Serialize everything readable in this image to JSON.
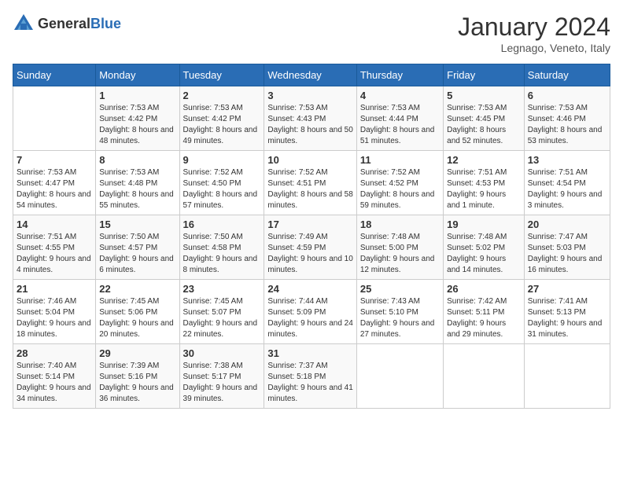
{
  "header": {
    "logo_general": "General",
    "logo_blue": "Blue",
    "month": "January 2024",
    "location": "Legnago, Veneto, Italy"
  },
  "weekdays": [
    "Sunday",
    "Monday",
    "Tuesday",
    "Wednesday",
    "Thursday",
    "Friday",
    "Saturday"
  ],
  "weeks": [
    [
      {
        "day": "",
        "sunrise": "",
        "sunset": "",
        "daylight": ""
      },
      {
        "day": "1",
        "sunrise": "Sunrise: 7:53 AM",
        "sunset": "Sunset: 4:42 PM",
        "daylight": "Daylight: 8 hours and 48 minutes."
      },
      {
        "day": "2",
        "sunrise": "Sunrise: 7:53 AM",
        "sunset": "Sunset: 4:42 PM",
        "daylight": "Daylight: 8 hours and 49 minutes."
      },
      {
        "day": "3",
        "sunrise": "Sunrise: 7:53 AM",
        "sunset": "Sunset: 4:43 PM",
        "daylight": "Daylight: 8 hours and 50 minutes."
      },
      {
        "day": "4",
        "sunrise": "Sunrise: 7:53 AM",
        "sunset": "Sunset: 4:44 PM",
        "daylight": "Daylight: 8 hours and 51 minutes."
      },
      {
        "day": "5",
        "sunrise": "Sunrise: 7:53 AM",
        "sunset": "Sunset: 4:45 PM",
        "daylight": "Daylight: 8 hours and 52 minutes."
      },
      {
        "day": "6",
        "sunrise": "Sunrise: 7:53 AM",
        "sunset": "Sunset: 4:46 PM",
        "daylight": "Daylight: 8 hours and 53 minutes."
      }
    ],
    [
      {
        "day": "7",
        "sunrise": "Sunrise: 7:53 AM",
        "sunset": "Sunset: 4:47 PM",
        "daylight": "Daylight: 8 hours and 54 minutes."
      },
      {
        "day": "8",
        "sunrise": "Sunrise: 7:53 AM",
        "sunset": "Sunset: 4:48 PM",
        "daylight": "Daylight: 8 hours and 55 minutes."
      },
      {
        "day": "9",
        "sunrise": "Sunrise: 7:52 AM",
        "sunset": "Sunset: 4:50 PM",
        "daylight": "Daylight: 8 hours and 57 minutes."
      },
      {
        "day": "10",
        "sunrise": "Sunrise: 7:52 AM",
        "sunset": "Sunset: 4:51 PM",
        "daylight": "Daylight: 8 hours and 58 minutes."
      },
      {
        "day": "11",
        "sunrise": "Sunrise: 7:52 AM",
        "sunset": "Sunset: 4:52 PM",
        "daylight": "Daylight: 8 hours and 59 minutes."
      },
      {
        "day": "12",
        "sunrise": "Sunrise: 7:51 AM",
        "sunset": "Sunset: 4:53 PM",
        "daylight": "Daylight: 9 hours and 1 minute."
      },
      {
        "day": "13",
        "sunrise": "Sunrise: 7:51 AM",
        "sunset": "Sunset: 4:54 PM",
        "daylight": "Daylight: 9 hours and 3 minutes."
      }
    ],
    [
      {
        "day": "14",
        "sunrise": "Sunrise: 7:51 AM",
        "sunset": "Sunset: 4:55 PM",
        "daylight": "Daylight: 9 hours and 4 minutes."
      },
      {
        "day": "15",
        "sunrise": "Sunrise: 7:50 AM",
        "sunset": "Sunset: 4:57 PM",
        "daylight": "Daylight: 9 hours and 6 minutes."
      },
      {
        "day": "16",
        "sunrise": "Sunrise: 7:50 AM",
        "sunset": "Sunset: 4:58 PM",
        "daylight": "Daylight: 9 hours and 8 minutes."
      },
      {
        "day": "17",
        "sunrise": "Sunrise: 7:49 AM",
        "sunset": "Sunset: 4:59 PM",
        "daylight": "Daylight: 9 hours and 10 minutes."
      },
      {
        "day": "18",
        "sunrise": "Sunrise: 7:48 AM",
        "sunset": "Sunset: 5:00 PM",
        "daylight": "Daylight: 9 hours and 12 minutes."
      },
      {
        "day": "19",
        "sunrise": "Sunrise: 7:48 AM",
        "sunset": "Sunset: 5:02 PM",
        "daylight": "Daylight: 9 hours and 14 minutes."
      },
      {
        "day": "20",
        "sunrise": "Sunrise: 7:47 AM",
        "sunset": "Sunset: 5:03 PM",
        "daylight": "Daylight: 9 hours and 16 minutes."
      }
    ],
    [
      {
        "day": "21",
        "sunrise": "Sunrise: 7:46 AM",
        "sunset": "Sunset: 5:04 PM",
        "daylight": "Daylight: 9 hours and 18 minutes."
      },
      {
        "day": "22",
        "sunrise": "Sunrise: 7:45 AM",
        "sunset": "Sunset: 5:06 PM",
        "daylight": "Daylight: 9 hours and 20 minutes."
      },
      {
        "day": "23",
        "sunrise": "Sunrise: 7:45 AM",
        "sunset": "Sunset: 5:07 PM",
        "daylight": "Daylight: 9 hours and 22 minutes."
      },
      {
        "day": "24",
        "sunrise": "Sunrise: 7:44 AM",
        "sunset": "Sunset: 5:09 PM",
        "daylight": "Daylight: 9 hours and 24 minutes."
      },
      {
        "day": "25",
        "sunrise": "Sunrise: 7:43 AM",
        "sunset": "Sunset: 5:10 PM",
        "daylight": "Daylight: 9 hours and 27 minutes."
      },
      {
        "day": "26",
        "sunrise": "Sunrise: 7:42 AM",
        "sunset": "Sunset: 5:11 PM",
        "daylight": "Daylight: 9 hours and 29 minutes."
      },
      {
        "day": "27",
        "sunrise": "Sunrise: 7:41 AM",
        "sunset": "Sunset: 5:13 PM",
        "daylight": "Daylight: 9 hours and 31 minutes."
      }
    ],
    [
      {
        "day": "28",
        "sunrise": "Sunrise: 7:40 AM",
        "sunset": "Sunset: 5:14 PM",
        "daylight": "Daylight: 9 hours and 34 minutes."
      },
      {
        "day": "29",
        "sunrise": "Sunrise: 7:39 AM",
        "sunset": "Sunset: 5:16 PM",
        "daylight": "Daylight: 9 hours and 36 minutes."
      },
      {
        "day": "30",
        "sunrise": "Sunrise: 7:38 AM",
        "sunset": "Sunset: 5:17 PM",
        "daylight": "Daylight: 9 hours and 39 minutes."
      },
      {
        "day": "31",
        "sunrise": "Sunrise: 7:37 AM",
        "sunset": "Sunset: 5:18 PM",
        "daylight": "Daylight: 9 hours and 41 minutes."
      },
      {
        "day": "",
        "sunrise": "",
        "sunset": "",
        "daylight": ""
      },
      {
        "day": "",
        "sunrise": "",
        "sunset": "",
        "daylight": ""
      },
      {
        "day": "",
        "sunrise": "",
        "sunset": "",
        "daylight": ""
      }
    ]
  ]
}
